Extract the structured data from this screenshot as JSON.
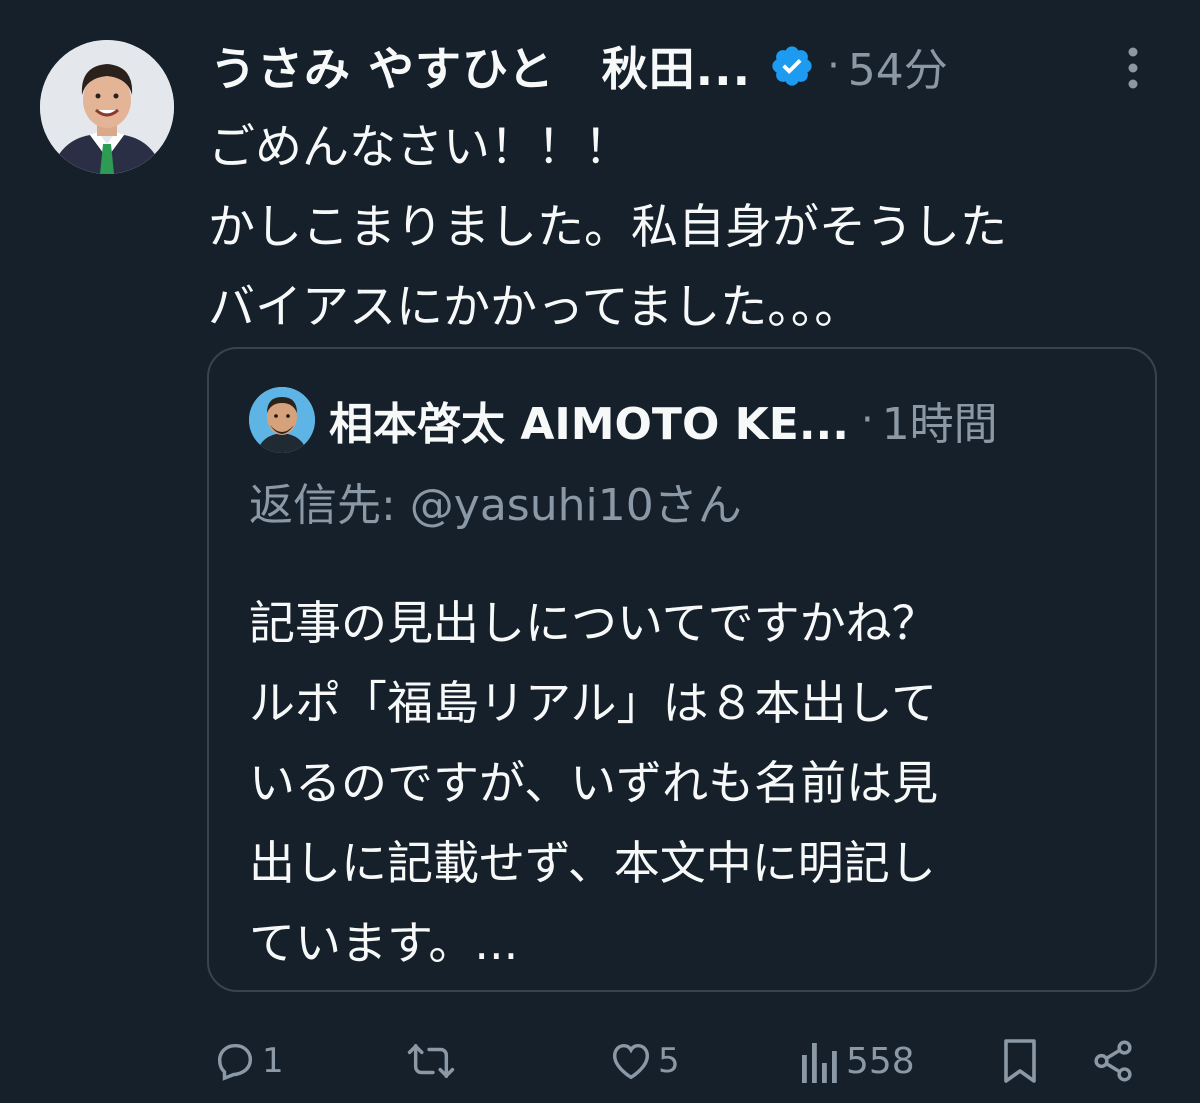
{
  "tweet": {
    "author_name": "うさみ やすひと　秋田...",
    "time": "54分",
    "dot": "·",
    "lines": [
      "ごめんなさい！！！",
      "かしこまりました。私自身がそうした",
      "バイアスにかかってました。。。"
    ]
  },
  "quote": {
    "author_name": "相本啓太 AIMOTO KE...",
    "time": "1時間",
    "dot": "·",
    "reply_to": "返信先: @yasuhi10さん",
    "lines": [
      "記事の見出しについてですかね？",
      "ルポ「福島リアル」は８本出して",
      "いるのですが、いずれも名前は見",
      "出しに記載せず、本文中に明記し",
      "ています。..."
    ]
  },
  "actions": {
    "reply_count": "1",
    "retweet_count": "",
    "like_count": "5",
    "view_count": "558"
  },
  "colors": {
    "background": "#15202b",
    "text": "#f7f9f9",
    "secondary": "#8b98a5",
    "verified": "#1d9bf0",
    "border": "#38444d"
  },
  "icons": [
    "avatar",
    "verified-badge-icon",
    "more-options-icon",
    "reply-icon",
    "retweet-icon",
    "like-icon",
    "views-icon",
    "bookmark-icon",
    "share-icon"
  ]
}
